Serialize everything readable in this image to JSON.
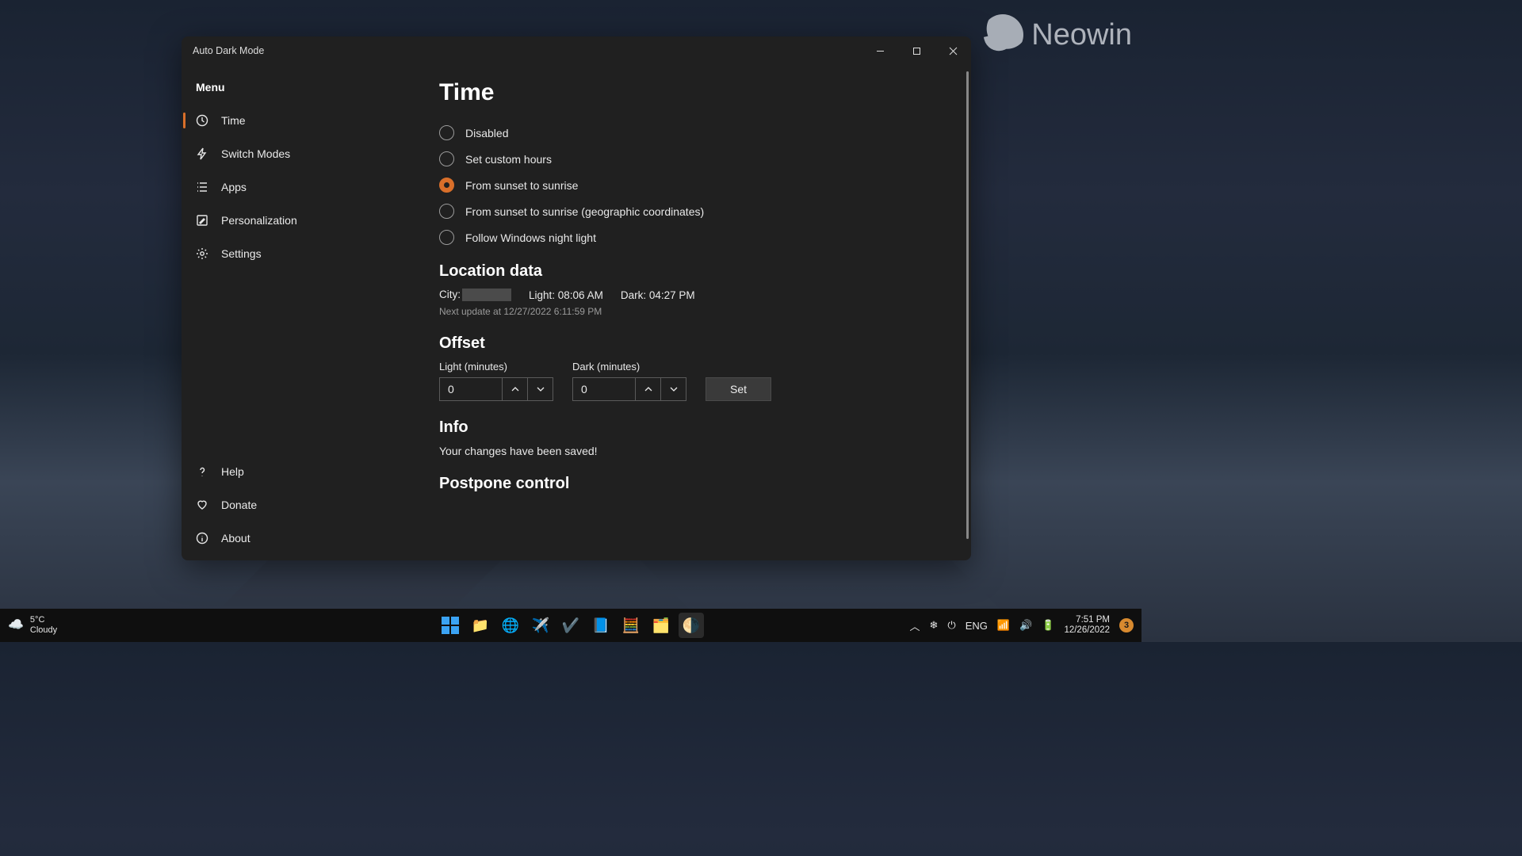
{
  "app": {
    "title": "Auto Dark Mode"
  },
  "sidebar": {
    "menu_label": "Menu",
    "items": [
      {
        "label": "Time"
      },
      {
        "label": "Switch Modes"
      },
      {
        "label": "Apps"
      },
      {
        "label": "Personalization"
      },
      {
        "label": "Settings"
      }
    ],
    "footer": [
      {
        "label": "Help"
      },
      {
        "label": "Donate"
      },
      {
        "label": "About"
      }
    ]
  },
  "page": {
    "title": "Time",
    "radios": {
      "disabled": "Disabled",
      "custom": "Set custom hours",
      "sunset": "From sunset to sunrise",
      "sunset_geo": "From sunset to sunrise (geographic coordinates)",
      "night_light": "Follow Windows night light"
    },
    "location": {
      "heading": "Location data",
      "city_label": "City:",
      "light_label": "Light: 08:06 AM",
      "dark_label": "Dark: 04:27 PM",
      "next_update": "Next update at  12/27/2022 6:11:59 PM"
    },
    "offset": {
      "heading": "Offset",
      "light_label": "Light (minutes)",
      "dark_label": "Dark (minutes)",
      "light_value": "0",
      "dark_value": "0",
      "set_label": "Set"
    },
    "info": {
      "heading": "Info",
      "msg": "Your changes have been saved!"
    },
    "postpone": {
      "heading": "Postpone control"
    }
  },
  "watermark": {
    "text": "Neowin"
  },
  "taskbar": {
    "weather": {
      "temp": "5°C",
      "cond": "Cloudy"
    },
    "lang": "ENG",
    "time": "7:51 PM",
    "date": "12/26/2022",
    "badge": "3"
  }
}
